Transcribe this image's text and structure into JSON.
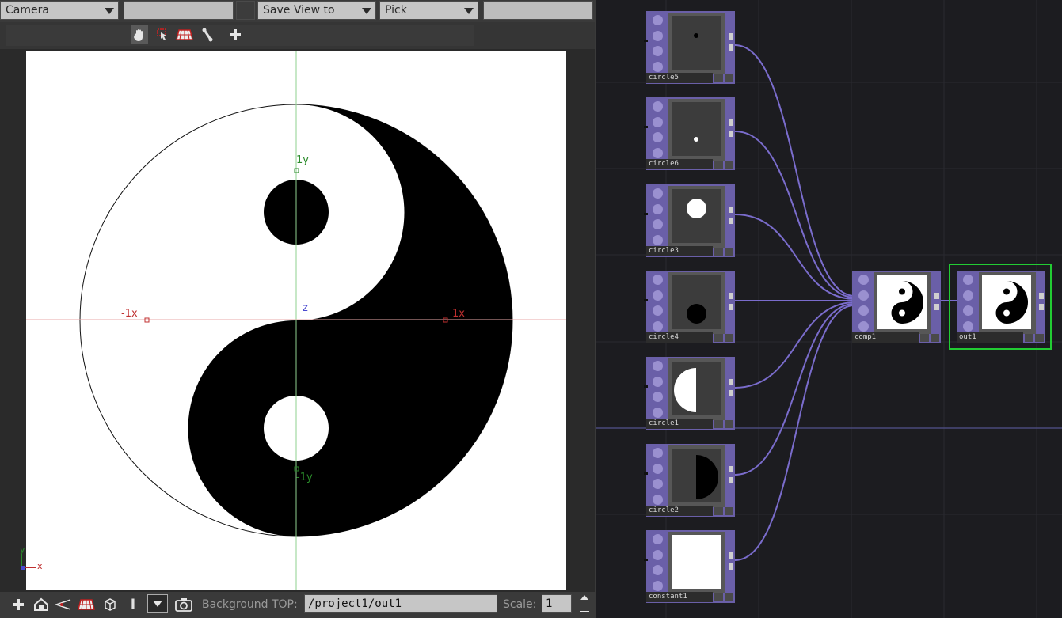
{
  "viewer": {
    "camera_dropdown": "Camera",
    "save_view_dropdown": "Save View to",
    "pick_dropdown": "Pick",
    "tools": [
      "hand-icon",
      "select-icon",
      "grid-icon",
      "bone-icon",
      "add-icon"
    ],
    "axis_labels": {
      "y_pos": "1y",
      "y_neg": "-1y",
      "x_pos": "1x",
      "x_neg": "-1x",
      "z": "z"
    },
    "corner_gizmo": {
      "y": "y",
      "x": "x"
    },
    "bottom": {
      "background_label": "Background TOP:",
      "background_value": "/project1/out1",
      "scale_label": "Scale:",
      "scale_value": "1",
      "info_label": "i"
    }
  },
  "network": {
    "nodes": [
      {
        "id": "circle5",
        "label": "circle5"
      },
      {
        "id": "circle6",
        "label": "circle6"
      },
      {
        "id": "circle3",
        "label": "circle3"
      },
      {
        "id": "circle4",
        "label": "circle4"
      },
      {
        "id": "circle1",
        "label": "circle1"
      },
      {
        "id": "circle2",
        "label": "circle2"
      },
      {
        "id": "constant1",
        "label": "constant1"
      },
      {
        "id": "comp1",
        "label": "comp1"
      },
      {
        "id": "out1",
        "label": "out1"
      }
    ],
    "colors": {
      "wire": "#7a6ccc",
      "node": "#6a5fa8",
      "selected": "#22cc33"
    }
  }
}
